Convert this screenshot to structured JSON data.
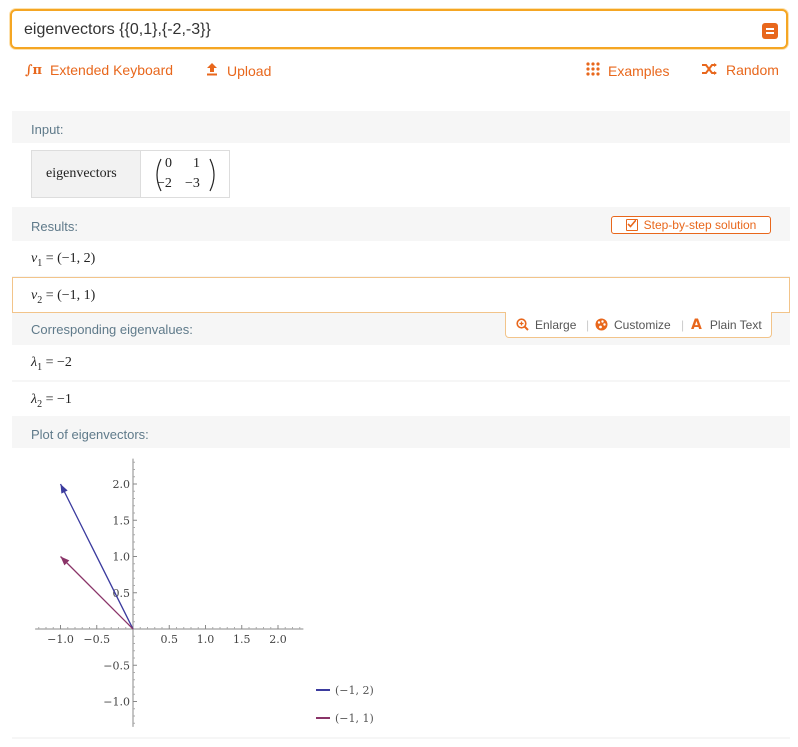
{
  "search": {
    "query": "eigenvectors {{0,1},{-2,-3}}"
  },
  "toolbar": {
    "extended_keyboard": "Extended Keyboard",
    "upload": "Upload",
    "examples": "Examples",
    "random": "Random"
  },
  "input": {
    "label": "Input:",
    "function": "eigenvectors",
    "matrix": [
      [
        "0",
        "1"
      ],
      [
        "−2",
        "−3"
      ]
    ]
  },
  "results": {
    "label": "Results:",
    "step_button": "Step-by-step solution",
    "v1_lhs": "v",
    "v1_sub": "1",
    "v1_rhs": "= (−1, 2)",
    "v2_lhs": "v",
    "v2_sub": "2",
    "v2_rhs": "= (−1, 1)"
  },
  "hover_actions": {
    "enlarge": "Enlarge",
    "customize": "Customize",
    "plain_text": "Plain Text"
  },
  "eigenvalues": {
    "label": "Corresponding eigenvalues:",
    "l1_sym": "λ",
    "l1_sub": "1",
    "l1_rhs": "= −2",
    "l2_sym": "λ",
    "l2_sub": "2",
    "l2_rhs": "= −1"
  },
  "plot": {
    "label": "Plot of eigenvectors:"
  },
  "chart_data": {
    "type": "line",
    "xlim": [
      -1.35,
      2.35
    ],
    "ylim": [
      -1.35,
      2.35
    ],
    "x_ticks": [
      "−1.0",
      "−0.5",
      "0.5",
      "1.0",
      "1.5",
      "2.0"
    ],
    "x_tick_values": [
      -1.0,
      -0.5,
      0.5,
      1.0,
      1.5,
      2.0
    ],
    "y_ticks": [
      "2.0",
      "1.5",
      "1.0",
      "0.5",
      "−0.5",
      "−1.0"
    ],
    "y_tick_values": [
      2.0,
      1.5,
      1.0,
      0.5,
      -0.5,
      -1.0
    ],
    "series": [
      {
        "name": "(−1, 2)",
        "x": [
          0,
          -1
        ],
        "y": [
          0,
          2
        ],
        "color": "#3b3b9e"
      },
      {
        "name": "(−1, 1)",
        "x": [
          0,
          -1
        ],
        "y": [
          0,
          1
        ],
        "color": "#8a3468"
      }
    ],
    "legend": "bottom-right"
  }
}
